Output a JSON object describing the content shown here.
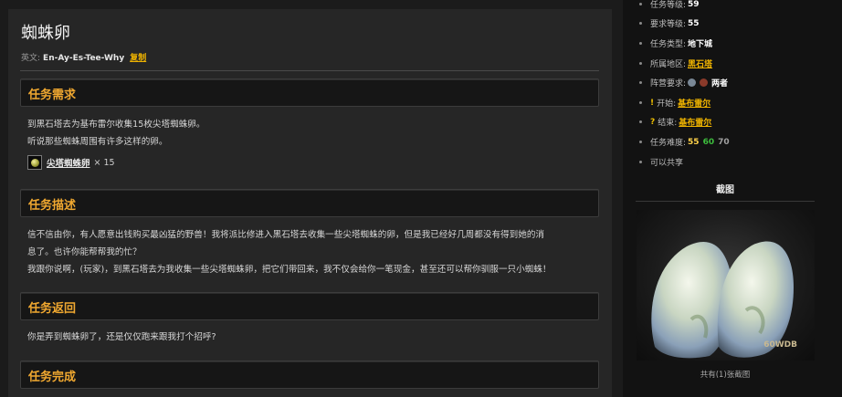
{
  "quest": {
    "title": "蜘蛛卵",
    "english_label": "英文:",
    "english_name": "En-Ay-Es-Tee-Why",
    "copy_label": "复制"
  },
  "sections": {
    "requirements": {
      "heading": "任务需求",
      "lines": [
        "到黑石塔去为基布雷尔收集15枚尖塔蜘蛛卵。",
        "听说那些蜘蛛周围有许多这样的卵。"
      ],
      "item_name": "尖塔蜘蛛卵",
      "item_qty": "× 15",
      "item_icon": "spider-egg-icon"
    },
    "description": {
      "heading": "任务描述",
      "lines": [
        "信不信由你，有人愿意出钱购买最凶猛的野兽！我将派比修进入黑石塔去收集一些尖塔蜘蛛的卵，但是我已经好几周都没有得到她的消",
        "息了。也许你能帮帮我的忙？",
        "我跟你说啊，(玩家)，到黑石塔去为我收集一些尖塔蜘蛛卵，把它们带回来，我不仅会给你一笔现金，甚至还可以帮你驯服一只小蜘蛛！"
      ]
    },
    "return": {
      "heading": "任务返回",
      "lines": [
        "你是弄到蜘蛛卵了，还是仅仅跑来跟我打个招呼?"
      ]
    },
    "complete": {
      "heading": "任务完成"
    }
  },
  "sidebar": {
    "level": {
      "label": "任务等级:",
      "value": "59"
    },
    "req_level": {
      "label": "要求等级:",
      "value": "55"
    },
    "type": {
      "label": "任务类型:",
      "value": "地下城"
    },
    "zone": {
      "label": "所属地区:",
      "value": "黑石塔"
    },
    "faction": {
      "label": "阵营要求:",
      "value": "两者"
    },
    "start": {
      "mark": "!",
      "label": "开始:",
      "value": "基布雷尔"
    },
    "end": {
      "mark": "?",
      "label": "结束:",
      "value": "基布雷尔"
    },
    "difficulty": {
      "label": "任务难度:",
      "values": [
        "55",
        "60",
        "70"
      ]
    },
    "shareable": "可以共享",
    "screenshot_title": "截图",
    "screenshot_caption": "共有(1)张截图",
    "watermark": "60WDB",
    "colors": {
      "accent": "#f0b400",
      "heading": "#f0a830",
      "green": "#3dbd3d",
      "yellow": "#ffd24a"
    }
  }
}
